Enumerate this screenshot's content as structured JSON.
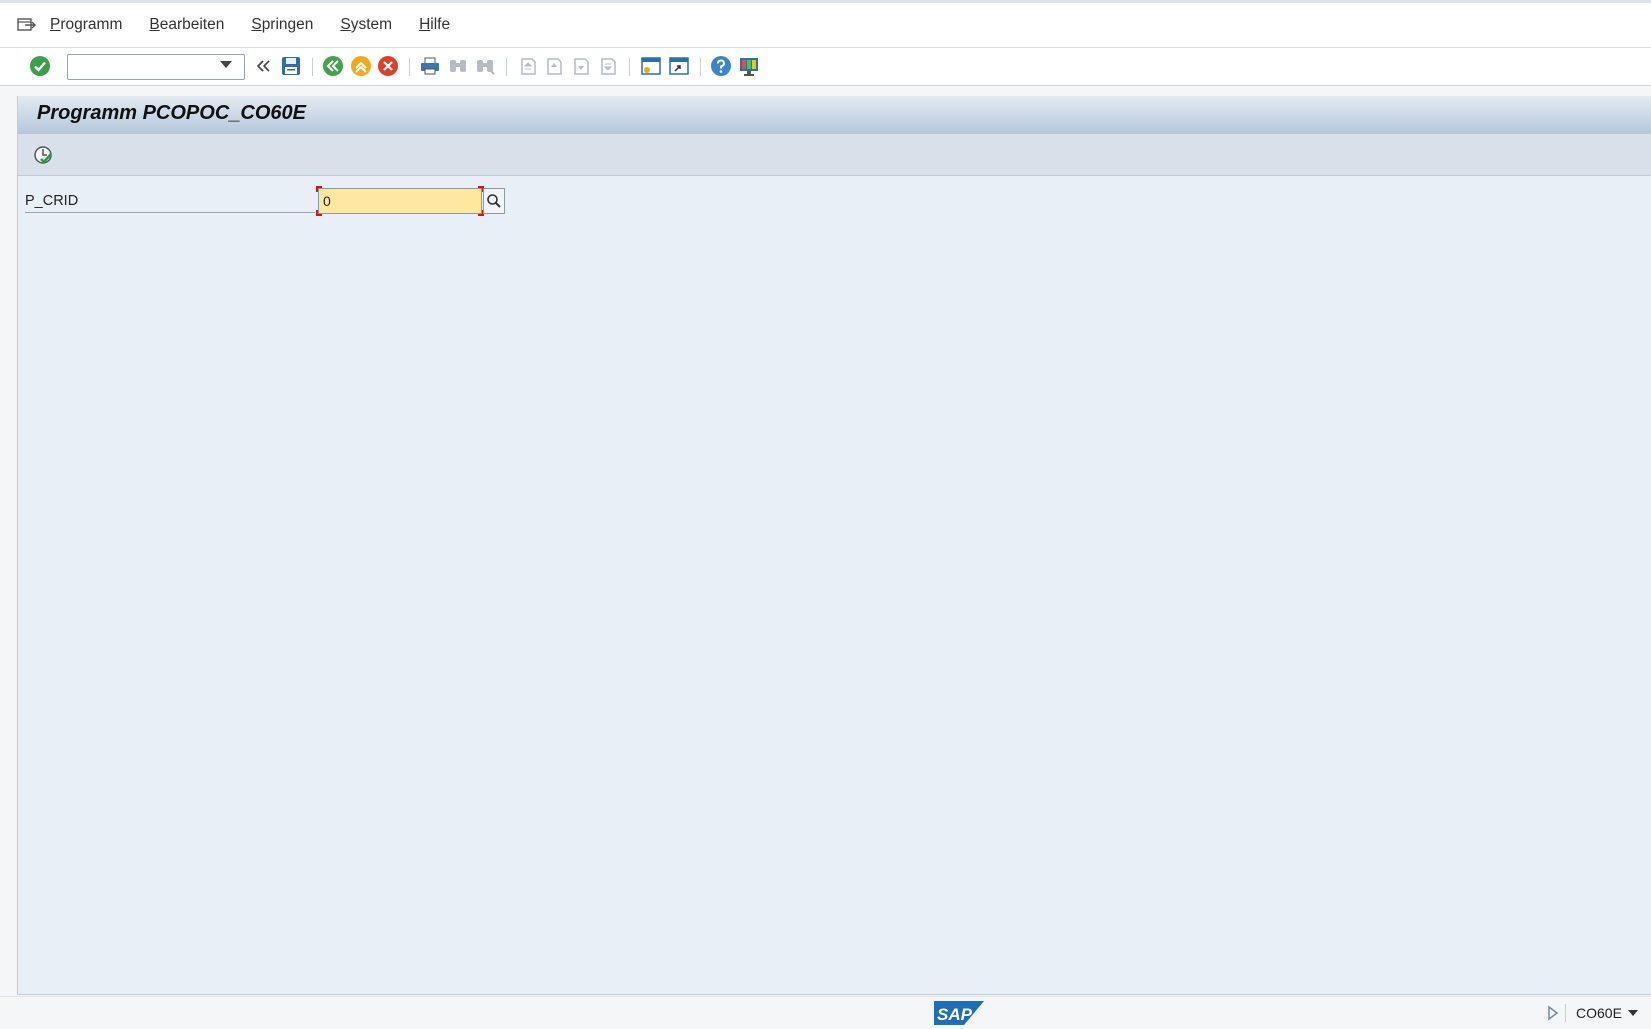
{
  "menubar": {
    "items": [
      {
        "mnemonic": "P",
        "rest": "rogramm"
      },
      {
        "mnemonic": "B",
        "rest": "earbeiten"
      },
      {
        "mnemonic": "S",
        "rest": "pringen"
      },
      {
        "mnemonic": "S",
        "rest": "ystem"
      },
      {
        "mnemonic": "H",
        "rest": "ilfe"
      }
    ]
  },
  "toolbar": {
    "command_field_value": "",
    "icons": [
      "enter-icon",
      "back-arrows-icon",
      "save-icon",
      "back-icon",
      "exit-icon",
      "cancel-icon",
      "print-icon",
      "find-icon",
      "find-next-icon",
      "first-page-icon",
      "prev-page-icon",
      "next-page-icon",
      "last-page-icon",
      "new-session-icon",
      "shortcut-icon",
      "help-icon",
      "layout-icon"
    ]
  },
  "page": {
    "title": "Programm PCOPOC_CO60E"
  },
  "params": {
    "p_crid_label": "P_CRID",
    "p_crid_value": "0"
  },
  "statusbar": {
    "logo_text": "SAP",
    "tcode": "CO60E"
  },
  "colors": {
    "main_bg": "#e8eff7",
    "input_required_bg": "#fde89d",
    "sap_blue": "#1e6fb8"
  }
}
